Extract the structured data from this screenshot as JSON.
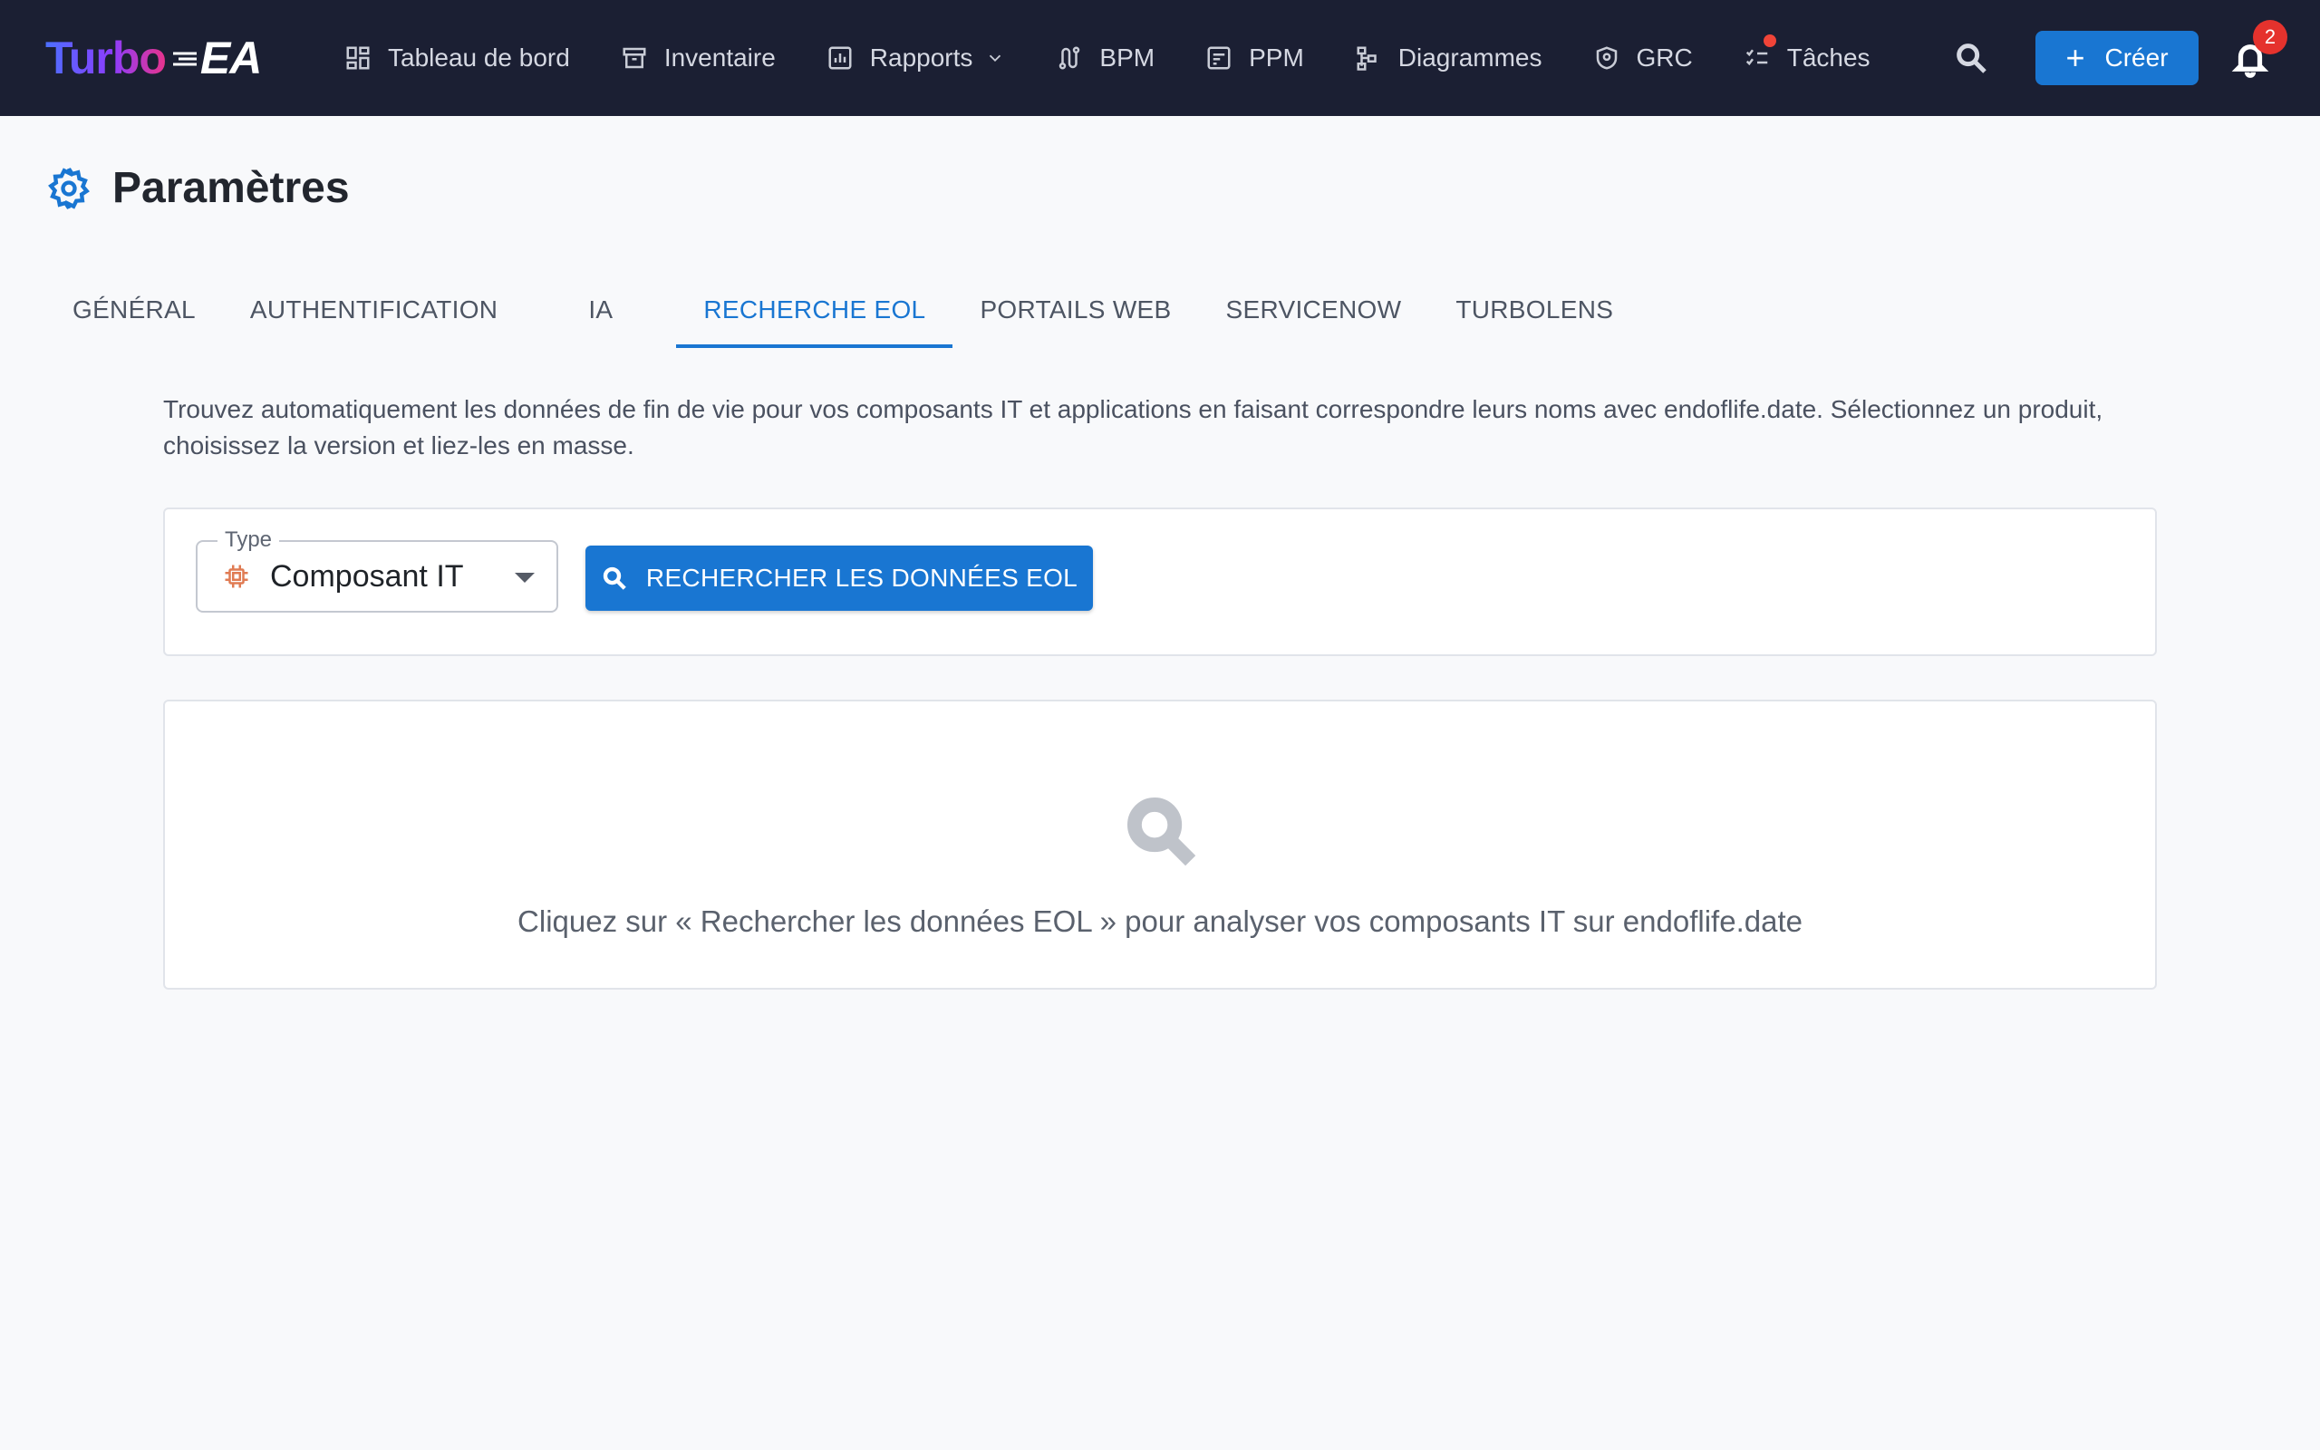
{
  "app": {
    "logo_part1": "Turbo",
    "logo_part2": "EA"
  },
  "nav": {
    "items": [
      {
        "label": "Tableau de bord",
        "icon": "dashboard-icon"
      },
      {
        "label": "Inventaire",
        "icon": "archive-icon"
      },
      {
        "label": "Rapports",
        "icon": "report-chart-icon",
        "has_dropdown": true
      },
      {
        "label": "BPM",
        "icon": "route-icon"
      },
      {
        "label": "PPM",
        "icon": "project-icon"
      },
      {
        "label": "Diagrammes",
        "icon": "diagram-tree-icon"
      },
      {
        "label": "GRC",
        "icon": "shield-icon"
      },
      {
        "label": "Tâches",
        "icon": "checklist-icon",
        "has_dot": true
      }
    ],
    "create_label": "Créer",
    "notification_count": "2"
  },
  "page": {
    "title": "Paramètres",
    "title_icon": "gear-icon"
  },
  "tabs": [
    {
      "label": "GÉNÉRAL",
      "active": false
    },
    {
      "label": "AUTHENTIFICATION",
      "active": false
    },
    {
      "label": "IA",
      "active": false
    },
    {
      "label": "RECHERCHE EOL",
      "active": true
    },
    {
      "label": "PORTAILS WEB",
      "active": false
    },
    {
      "label": "SERVICENOW",
      "active": false
    },
    {
      "label": "TURBOLENS",
      "active": false
    }
  ],
  "eol": {
    "description": "Trouvez automatiquement les données de fin de vie pour vos composants IT et applications en faisant correspondre leurs noms avec endoflife.date. Sélectionnez un produit, choisissez la version et liez-les en masse.",
    "type_label": "Type",
    "type_value": "Composant IT",
    "search_button": "RECHERCHER LES DONNÉES EOL",
    "empty_message": "Cliquez sur « Rechercher les données EOL » pour analyser vos composants IT sur endoflife.date"
  },
  "colors": {
    "topbar": "#1b1f33",
    "accent": "#1976d2",
    "badge": "#e5322d",
    "chip_icon": "#e07b53"
  }
}
